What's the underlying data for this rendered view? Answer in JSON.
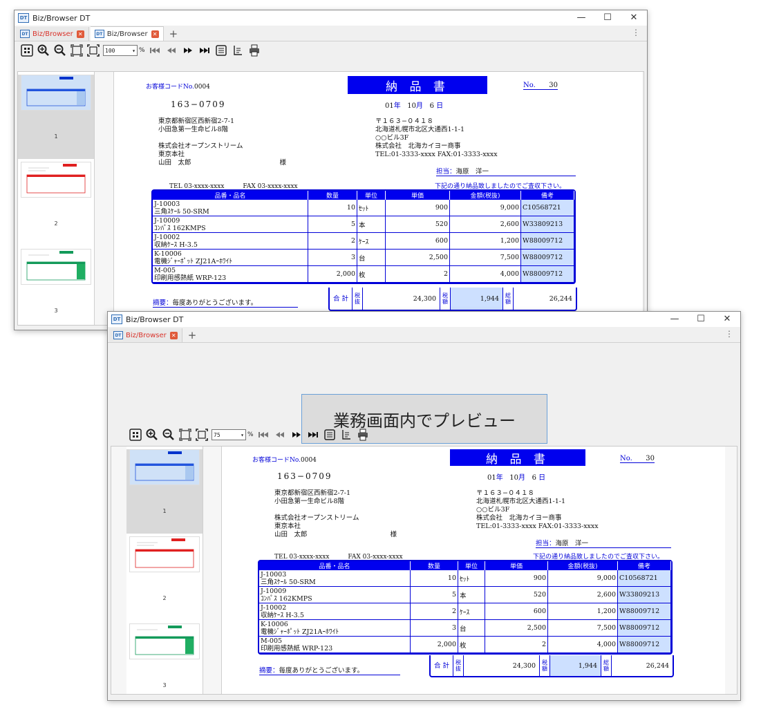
{
  "app": {
    "icon_text": "DT",
    "title": "Biz/Browser DT"
  },
  "window_controls": {
    "minimize": "—",
    "maximize": "☐",
    "close": "✕"
  },
  "window1": {
    "tabs": [
      {
        "label": "Biz/Browser"
      },
      {
        "label": "Biz/Browser"
      }
    ],
    "zoom": "100",
    "pct": "%"
  },
  "window2": {
    "tabs": [
      {
        "label": "Biz/Browser"
      }
    ],
    "zoom": "75",
    "pct": "%",
    "preview_button": "業務画面内でプレビュー"
  },
  "thumbnails": [
    "1",
    "2",
    "3"
  ],
  "invoice": {
    "customer_code_label": "お客様コードNo.",
    "customer_code": "0004",
    "title": "納 品 書",
    "no_label": "No.",
    "no_value": "30",
    "zip": "163−0709",
    "date_year": "01",
    "date_year_unit": "年",
    "date_month": "10",
    "date_month_unit": "月",
    "date_day": "6",
    "date_day_unit": "日",
    "recipient_lines": [
      "東京都新宿区西新宿2-7-1",
      "小田急第一生命ビル8階",
      "",
      "株式会社オープンストリーム",
      "東京本社",
      "山田　太郎"
    ],
    "honorific": "様",
    "sender_lines": [
      "〒１６３−０４１８",
      "北海道札幌市北区大通西1-1-1",
      "○○ビル3F",
      "株式会社　北海カイヨー商事",
      "TEL:01-3333-xxxx FAX:01-3333-xxxx"
    ],
    "tanto_label": "担当：",
    "tanto_name": "海原　洋一",
    "tel_fax": "TEL 03-xxxx-xxxx　　　FAX 03-xxxx-xxxx",
    "note": "下記の通り納品致しましたのでご査収下さい。",
    "headers": [
      "品番・品名",
      "数量",
      "単位",
      "単価",
      "金額(税抜)",
      "備考"
    ],
    "items": [
      {
        "code": "J-10003",
        "name": "三角ｽｹｰﾙ 50-SRM",
        "qty": "10",
        "unit": "ｾｯﾄ",
        "price": "900",
        "amount": "9,000",
        "memo": "C10568721"
      },
      {
        "code": "J-10009",
        "name": "ｺﾝﾊﾟｽ 162KMPS",
        "qty": "5",
        "unit": "本",
        "price": "520",
        "amount": "2,600",
        "memo": "W33809213"
      },
      {
        "code": "J-10002",
        "name": "収納ｹｰｽ H-3.5",
        "qty": "2",
        "unit": "ｹｰｽ",
        "price": "600",
        "amount": "1,200",
        "memo": "W88009712"
      },
      {
        "code": "K-10006",
        "name": "電機ｼﾞｬｰﾎﾟｯﾄ ZJ21Aｰﾎﾜｲﾄ",
        "qty": "3",
        "unit": "台",
        "price": "2,500",
        "amount": "7,500",
        "memo": "W88009712"
      },
      {
        "code": "M-005",
        "name": "印刷用感熱紙 WRP-123",
        "qty": "2,000",
        "unit": "枚",
        "price": "2",
        "amount": "4,000",
        "memo": "W88009712"
      }
    ],
    "memo_label": "摘要：",
    "memo_text": "毎度ありがとうございます。",
    "total_label": "合 計",
    "zeinuki_label": "税抜",
    "subtotal": "24,300",
    "tax_label": "税額",
    "tax": "1,944",
    "grand_label": "総額",
    "grand_total": "26,244"
  }
}
